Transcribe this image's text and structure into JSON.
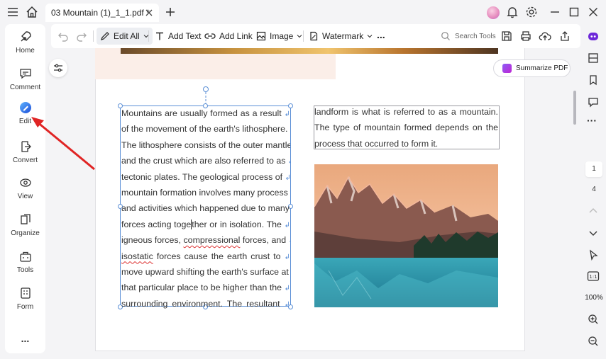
{
  "tab": {
    "title": "03 Mountain (1)_1_1.pdf *"
  },
  "sidebar": {
    "items": [
      {
        "label": "Home",
        "icon": "home-rocket-icon"
      },
      {
        "label": "Comment",
        "icon": "comment-icon"
      },
      {
        "label": "Edit",
        "icon": "edit-icon"
      },
      {
        "label": "Convert",
        "icon": "convert-icon"
      },
      {
        "label": "View",
        "icon": "view-icon"
      },
      {
        "label": "Organize",
        "icon": "organize-icon"
      },
      {
        "label": "Tools",
        "icon": "tools-icon"
      },
      {
        "label": "Form",
        "icon": "form-icon"
      }
    ],
    "more": "..."
  },
  "toolbar": {
    "edit_all": "Edit All",
    "add_text": "Add Text",
    "add_link": "Add Link",
    "image": "Image",
    "watermark": "Watermark",
    "more": "...",
    "search_placeholder": "Search Tools"
  },
  "summarize": {
    "label": "Summarize PDF"
  },
  "document": {
    "block1_lines": [
      "Mountains are usually formed as a result",
      "of the movement of the earth's lithosphere.",
      "The lithosphere consists of the outer mantle",
      "and the crust which are also referred to as",
      "tectonic plates. The geological process of",
      "mountain formation involves many process",
      "and activities which happened due to many",
      "forces acting together or in isolation. The",
      "igneous forces, compressional forces, and",
      "isostatic forces cause the earth crust to",
      "move upward shifting the earth's surface at",
      "that particular place to be higher than the",
      "surrounding environment. The resultant"
    ],
    "block2_lines": [
      "landform is what is referred to as a mountain.",
      "The type of mountain formed depends on the",
      "process that occurred to form it."
    ],
    "caret_split": [
      "forces acting toge",
      "ther or in isolation. The"
    ]
  },
  "pagination": {
    "current": "1",
    "total": "4"
  },
  "zoom": "100%",
  "colors": {
    "accent": "#5b8fd6",
    "arrow": "#e02424",
    "spell_error": "#dd3333"
  }
}
